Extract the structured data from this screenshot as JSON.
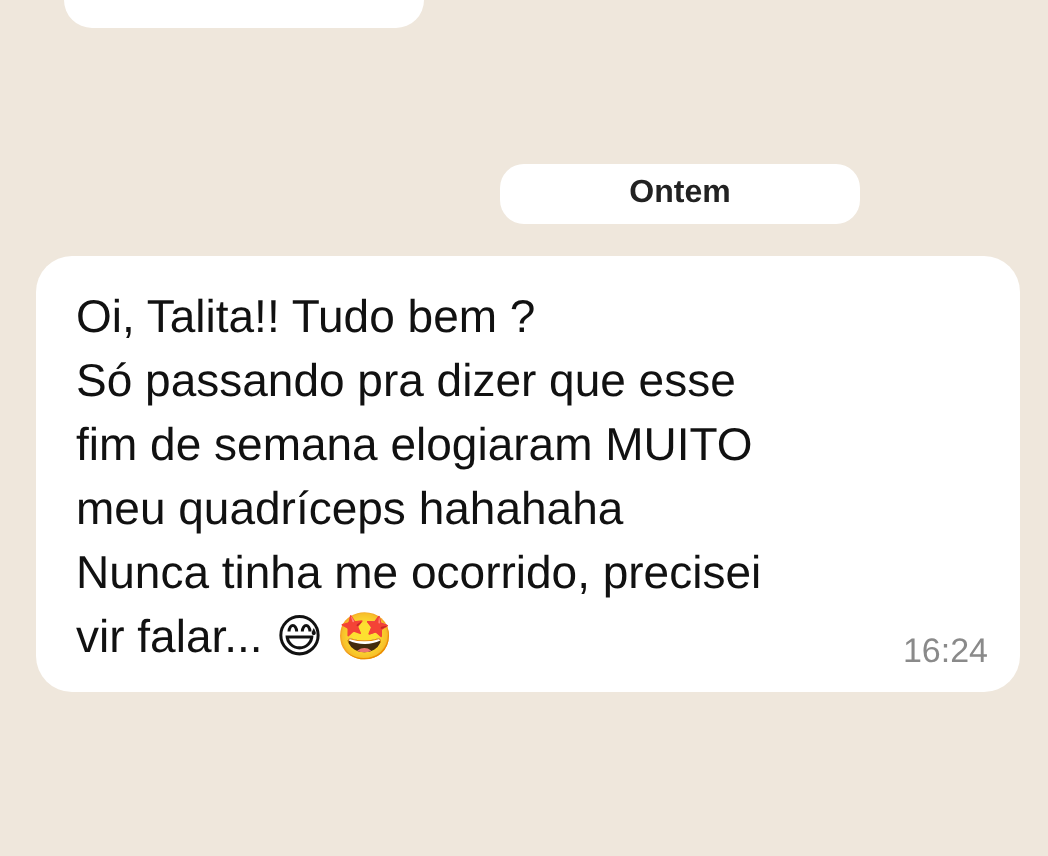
{
  "date_separator": "Ontem",
  "message": {
    "lines": [
      "Oi, Talita!! Tudo bem ?",
      "Só passando pra dizer que esse",
      "fim de semana elogiaram MUITO",
      "meu quadríceps hahahaha",
      "Nunca tinha me ocorrido, precisei",
      "vir falar... 😅 🤩"
    ],
    "time": "16:24"
  }
}
